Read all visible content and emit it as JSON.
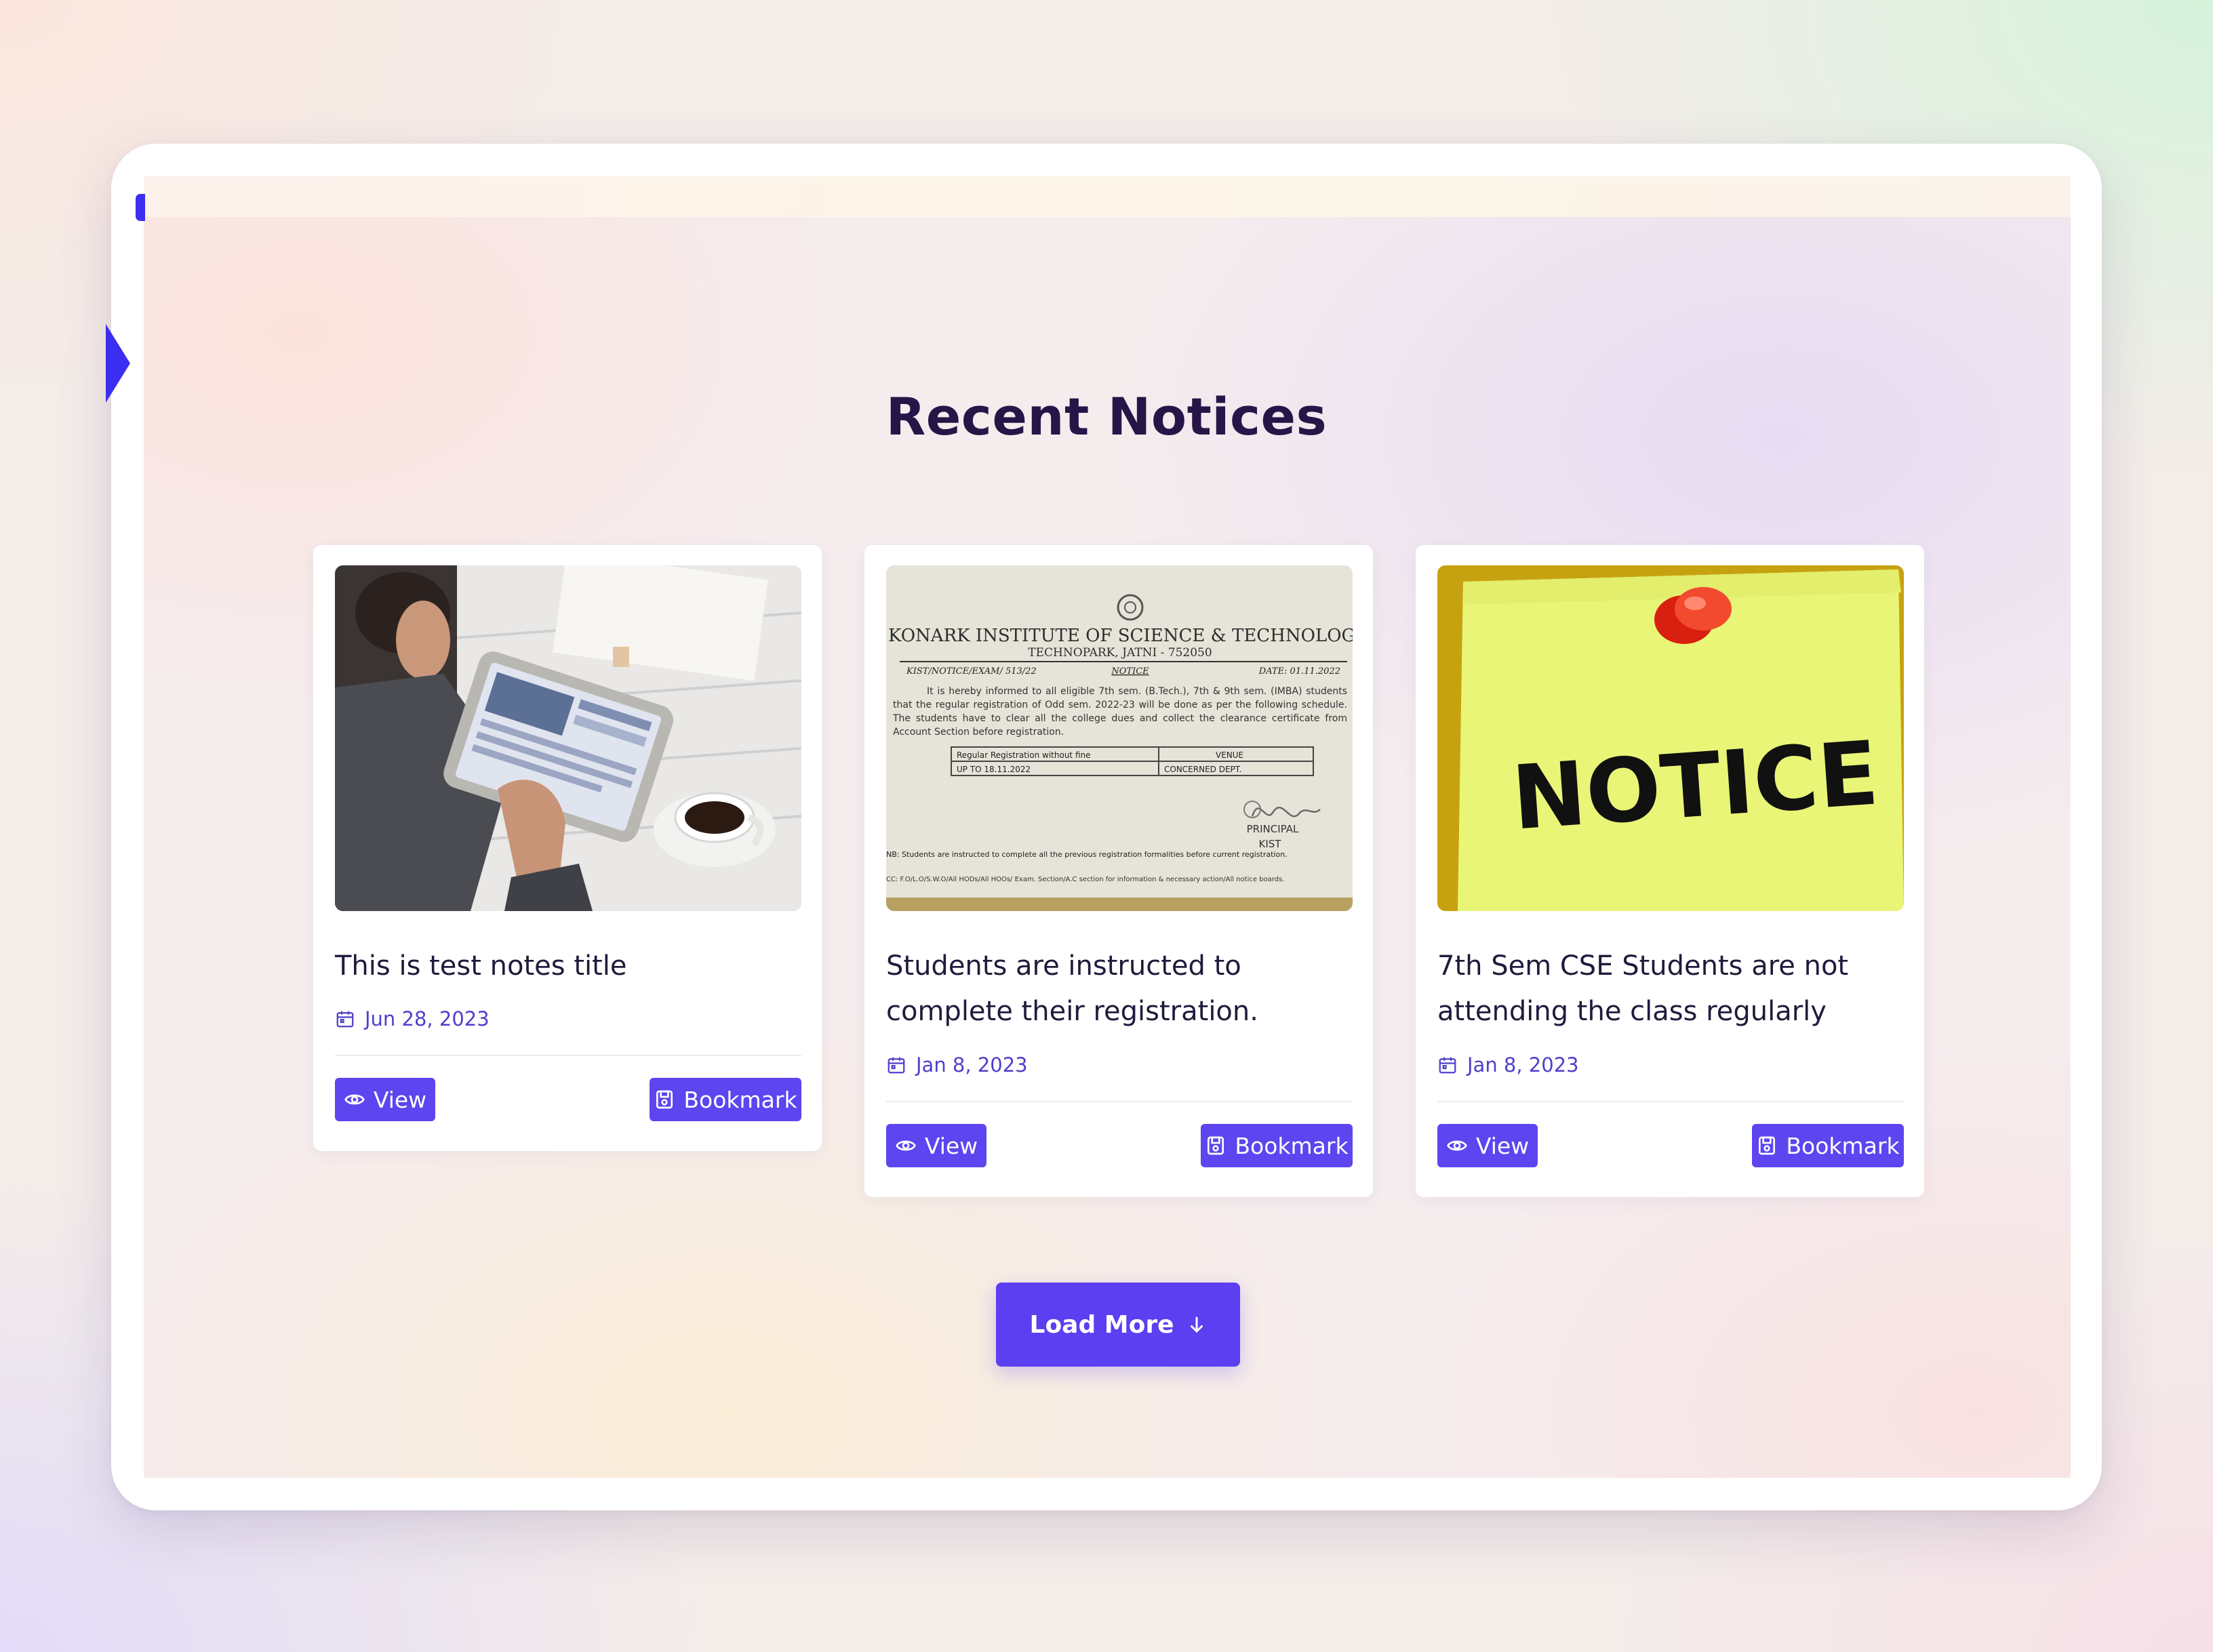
{
  "section": {
    "title": "Recent Notices"
  },
  "colors": {
    "accent": "#5d45ef",
    "title": "#271548",
    "date": "#4f3fcc"
  },
  "cards": [
    {
      "title": "This is test notes title",
      "date": "Jun 28, 2023",
      "image": "photo of man using a tablet at a desk",
      "view_label": "View",
      "bookmark_label": "Bookmark"
    },
    {
      "title": "Students are instructed to complete their registration.",
      "date": "Jan 8, 2023",
      "image": "scanned paper notice",
      "doc": {
        "institute": "KONARK INSTITUTE OF SCIENCE & TECHNOLOGY",
        "address": "TECHNOPARK, JATNI - 752050",
        "ref": "KIST/NOTICE/EXAM/ 513/22",
        "heading": "NOTICE",
        "date": "DATE: 01.11.2022",
        "body": "It is hereby informed to all eligible 7th sem. (B.Tech.), 7th & 9th sem. (IMBA) students that the regular registration of Odd sem. 2022-23 will be done as per the following schedule. The students have to clear all the college dues and collect the clearance certificate from Account Section before registration.",
        "col1_header": "Regular Registration without fine",
        "col2_header": "VENUE",
        "col1_value": "UP TO 18.11.2022",
        "col2_value": "CONCERNED DEPT.",
        "signer": "PRINCIPAL",
        "signer_org": "KIST",
        "footnote": "NB: Students are instructed to complete all the previous registration formalities before current registration.",
        "cc": "CC:    F.O/L.O/S.W.O/All HODs/All HOOs/ Exam. Section/A.C section for information & necessary action/All notice boards."
      },
      "view_label": "View",
      "bookmark_label": "Bookmark"
    },
    {
      "title": "7th Sem CSE Students are not attending the class regularly",
      "date": "Jan 8, 2023",
      "image": "yellow sticky note with red pushpin",
      "note_text": "NOTICE",
      "view_label": "View",
      "bookmark_label": "Bookmark"
    }
  ],
  "load_more": {
    "label": "Load More"
  }
}
